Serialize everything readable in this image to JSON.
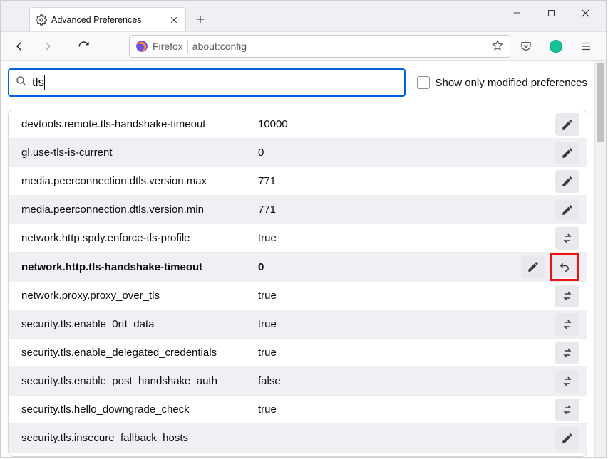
{
  "window": {
    "tab_title": "Advanced Preferences"
  },
  "urlbar": {
    "identity_label": "Firefox",
    "url": "about:config"
  },
  "search": {
    "value": "tls",
    "show_modified_label": "Show only modified preferences"
  },
  "prefs": [
    {
      "name": "devtools.remote.tls-handshake-timeout",
      "value": "10000",
      "action": "edit",
      "modified": false
    },
    {
      "name": "gl.use-tls-is-current",
      "value": "0",
      "action": "edit",
      "modified": false
    },
    {
      "name": "media.peerconnection.dtls.version.max",
      "value": "771",
      "action": "edit",
      "modified": false
    },
    {
      "name": "media.peerconnection.dtls.version.min",
      "value": "771",
      "action": "edit",
      "modified": false
    },
    {
      "name": "network.http.spdy.enforce-tls-profile",
      "value": "true",
      "action": "toggle",
      "modified": false
    },
    {
      "name": "network.http.tls-handshake-timeout",
      "value": "0",
      "action": "edit",
      "modified": true,
      "resettable": true
    },
    {
      "name": "network.proxy.proxy_over_tls",
      "value": "true",
      "action": "toggle",
      "modified": false
    },
    {
      "name": "security.tls.enable_0rtt_data",
      "value": "true",
      "action": "toggle",
      "modified": false
    },
    {
      "name": "security.tls.enable_delegated_credentials",
      "value": "true",
      "action": "toggle",
      "modified": false
    },
    {
      "name": "security.tls.enable_post_handshake_auth",
      "value": "false",
      "action": "toggle",
      "modified": false
    },
    {
      "name": "security.tls.hello_downgrade_check",
      "value": "true",
      "action": "toggle",
      "modified": false
    },
    {
      "name": "security.tls.insecure_fallback_hosts",
      "value": "",
      "action": "edit",
      "modified": false
    }
  ]
}
